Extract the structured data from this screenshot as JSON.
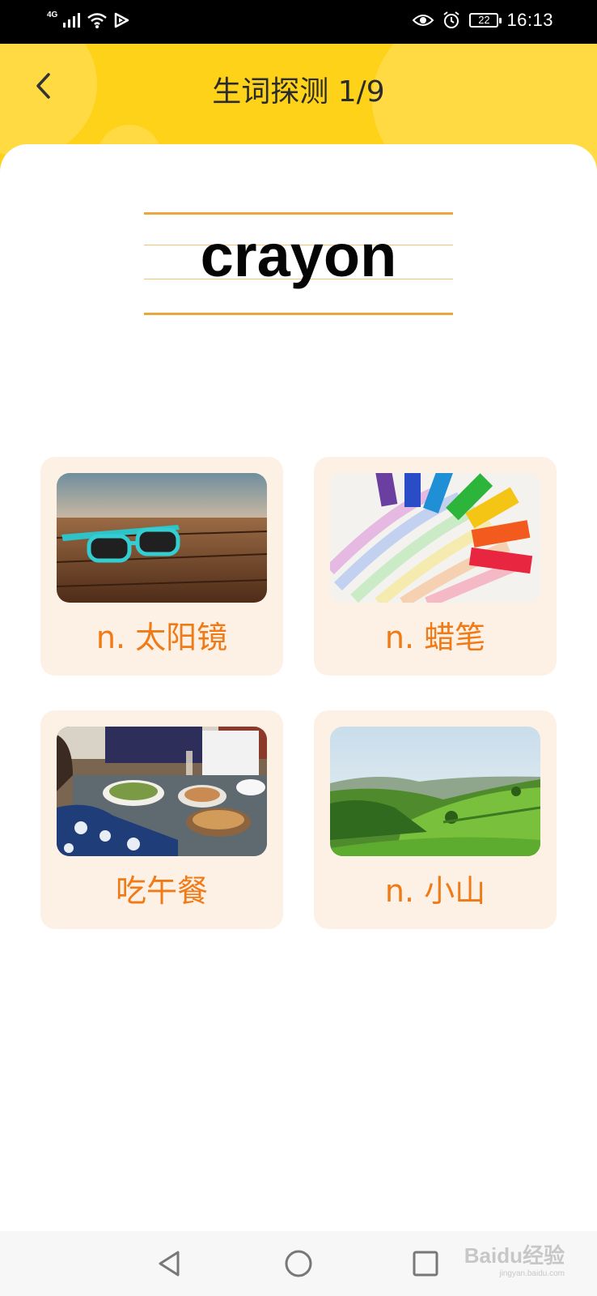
{
  "status_bar": {
    "network": "4G",
    "battery": "22",
    "time": "16:13"
  },
  "header": {
    "title": "生词探测 1/9",
    "accent_color": "#ffd21a"
  },
  "word": {
    "text": "crayon"
  },
  "options": [
    {
      "label": "n. 太阳镜",
      "image": "sunglasses-photo"
    },
    {
      "label": "n. 蜡笔",
      "image": "crayons-photo"
    },
    {
      "label": "吃午餐",
      "image": "lunch-table-photo"
    },
    {
      "label": "n. 小山",
      "image": "hills-photo"
    }
  ],
  "option_label_color": "#f07a16",
  "nav_bar": {
    "icons": [
      "back-triangle-icon",
      "home-circle-icon",
      "recents-square-icon"
    ]
  },
  "watermark": {
    "text": "Baidu经验",
    "url_text": "jingyan.baidu.com"
  }
}
